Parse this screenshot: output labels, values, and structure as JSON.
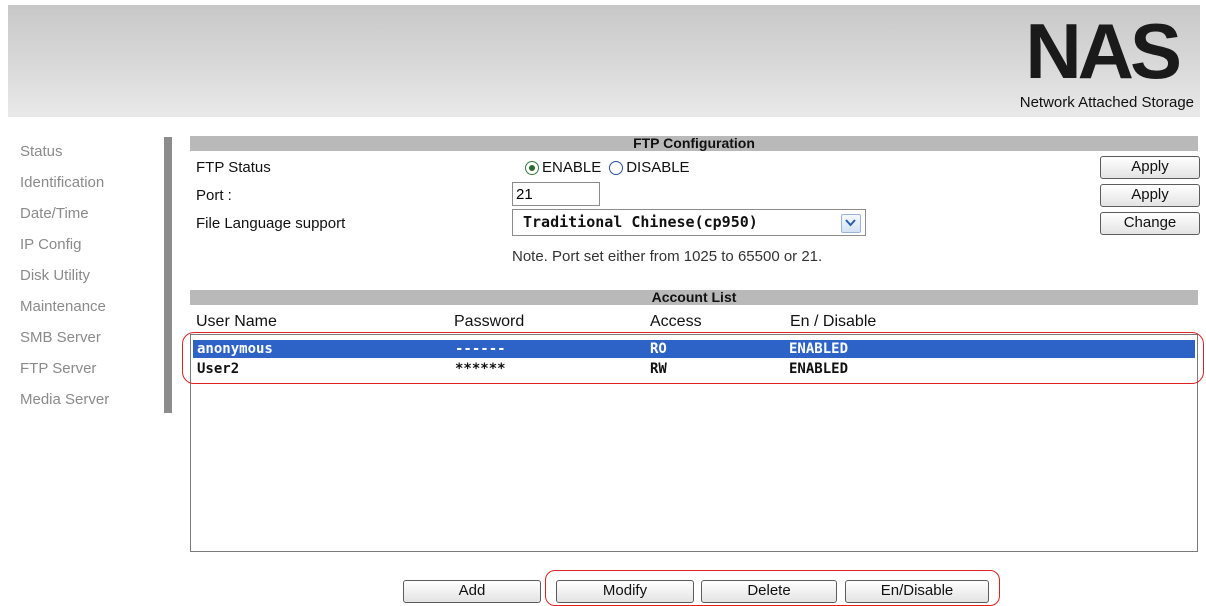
{
  "header": {
    "logo": "NAS",
    "subtitle": "Network Attached Storage"
  },
  "sidebar": {
    "items": [
      {
        "label": "Status"
      },
      {
        "label": "Identification"
      },
      {
        "label": "Date/Time"
      },
      {
        "label": "IP Config"
      },
      {
        "label": "Disk Utility"
      },
      {
        "label": "Maintenance"
      },
      {
        "label": "SMB Server"
      },
      {
        "label": "FTP Server"
      },
      {
        "label": "Media Server"
      }
    ]
  },
  "ftp_config": {
    "title": "FTP Configuration",
    "status_label": "FTP Status",
    "enable_label": "ENABLE",
    "disable_label": "DISABLE",
    "port_label": "Port :",
    "port_value": "21",
    "language_label": "File Language support",
    "language_value": "Traditional Chinese(cp950)",
    "apply_status": "Apply",
    "apply_port": "Apply",
    "change_language": "Change",
    "note": "Note. Port set either from 1025 to 65500 or 21."
  },
  "account_list": {
    "title": "Account List",
    "columns": [
      "User Name",
      "Password",
      "Access",
      "En / Disable"
    ],
    "rows": [
      {
        "user": "anonymous",
        "password": "------",
        "access": "RO",
        "status": "ENABLED"
      },
      {
        "user": "User2",
        "password": "******",
        "access": "RW",
        "status": "ENABLED"
      }
    ]
  },
  "actions": {
    "add": "Add",
    "modify": "Modify",
    "delete": "Delete",
    "endisable": "En/Disable"
  },
  "colors": {
    "selection": "#2d62c7",
    "section_bar": "#b9b9b9",
    "highlight_outline": "#dd2222"
  }
}
